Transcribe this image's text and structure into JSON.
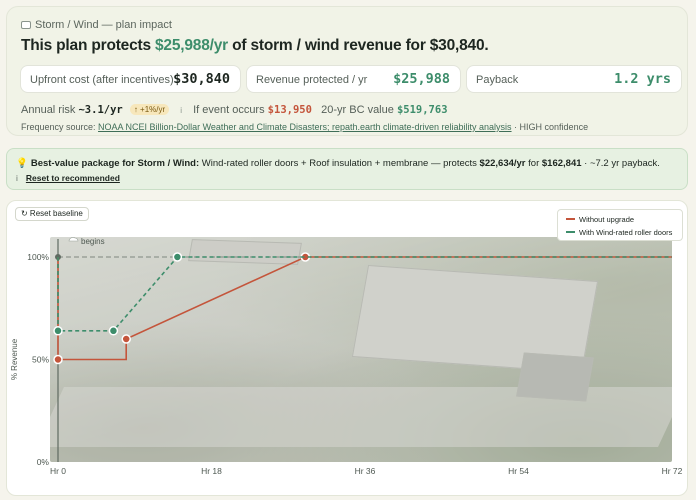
{
  "header": {
    "crumb": "Storm / Wind — plan impact",
    "headline_pre": "This plan protects ",
    "headline_amount": "$25,988/yr",
    "headline_post": " of storm / wind revenue for $30,840."
  },
  "metrics": [
    {
      "label": "Upfront cost (after incentives)",
      "value": "$30,840"
    },
    {
      "label": "Revenue protected / yr",
      "value": "$25,988"
    },
    {
      "label": "Payback",
      "value": "1.2 yrs"
    }
  ],
  "risk": {
    "annual_label": "Annual risk",
    "annual_value": "~3.1/yr",
    "trend_badge": "↑ +1%/yr",
    "info_icon": "i",
    "event_label": "If event occurs",
    "event_value": "$13,950",
    "bc_label": "20-yr BC value",
    "bc_value": "$519,763"
  },
  "source": {
    "prefix": "Frequency source: ",
    "link": "NOAA NCEI Billion-Dollar Weather and Climate Disasters; repath.earth climate-driven reliability analysis",
    "suffix": " · HIGH confidence"
  },
  "best": {
    "icon": "lightbulb-icon",
    "title": "Best-value package for Storm / Wind:",
    "desc_pre": " Wind-rated roller doors + Roof insulation + membrane — protects ",
    "amount": "$22,634/yr",
    "mid": " for ",
    "cost": "$162,841",
    "suffix": " · ~7.2 yr payback.",
    "info_icon": "i",
    "reset_link": "Reset to recommended"
  },
  "chart_controls": {
    "reset_baseline": "↻ Reset baseline"
  },
  "chart_data": {
    "type": "line",
    "ylabel": "% Revenue",
    "xlabel": "",
    "xlim": [
      0,
      72
    ],
    "ylim": [
      0,
      100
    ],
    "x_ticks": [
      0,
      18,
      36,
      54,
      72
    ],
    "x_tick_labels": [
      "Hr 0",
      "Hr 18",
      "Hr 36",
      "Hr 54",
      "Hr 72"
    ],
    "y_ticks": [
      0,
      50,
      100
    ],
    "y_tick_labels": [
      "0%",
      "50%",
      "100%"
    ],
    "event_marker": {
      "x": 0,
      "label": "begins"
    },
    "legend_position": "top-right",
    "series": [
      {
        "name": "Without upgrade",
        "color": "#c4553b",
        "dash": false,
        "points": [
          [
            0,
            100
          ],
          [
            0,
            50
          ],
          [
            8,
            50
          ],
          [
            8,
            60
          ],
          [
            29,
            100
          ],
          [
            72,
            100
          ]
        ],
        "markers": [
          [
            0,
            50
          ],
          [
            8,
            60
          ],
          [
            29,
            100
          ]
        ]
      },
      {
        "name": "With Wind-rated roller doors",
        "color": "#3d8d6b",
        "dash": true,
        "points": [
          [
            0,
            100
          ],
          [
            0,
            64
          ],
          [
            6.5,
            64
          ],
          [
            14,
            100
          ],
          [
            72,
            100
          ]
        ],
        "markers": [
          [
            0,
            64
          ],
          [
            6.5,
            64
          ],
          [
            14,
            100
          ]
        ]
      }
    ]
  }
}
